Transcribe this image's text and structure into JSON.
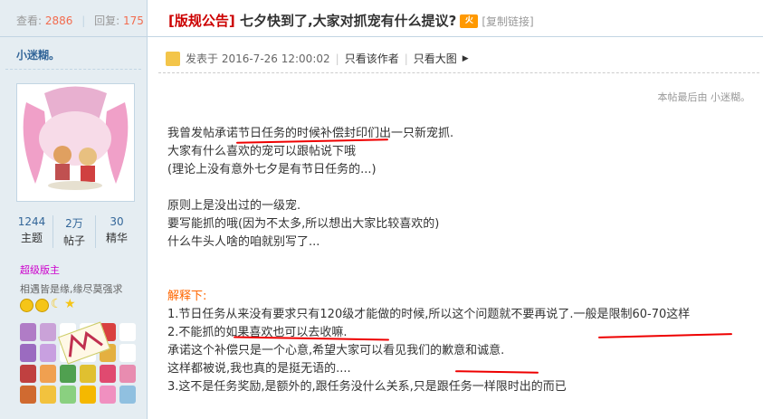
{
  "sidebar": {
    "views_label": "查看:",
    "views": "2886",
    "replies_label": "回复:",
    "replies": "175",
    "username": "小迷糊。",
    "counts": [
      {
        "value": "1244",
        "label": "主题"
      },
      {
        "value": "2万",
        "label": "帖子"
      },
      {
        "value": "30",
        "label": "精华"
      }
    ],
    "role": "超级版主",
    "motto": "相遇皆是缘,缘尽莫强求"
  },
  "post": {
    "tag": "[版规公告]",
    "title": " 七夕快到了,大家对抓宠有什么提议?",
    "copy_link": "[复制链接]",
    "posted_at": "发表于 2016-7-26 12:00:02",
    "only_author": "只看该作者",
    "view_large": "只看大图",
    "last_edit": "本帖最后由 小迷糊。",
    "lines": [
      "我曾发帖承诺节日任务的时候补偿封印们出一只新宠抓.",
      "大家有什么喜欢的宠可以跟帖说下哦",
      "(理论上没有意外七夕是有节日任务的...)",
      "",
      "原则上是没出过的一级宠.",
      "要写能抓的哦(因为不太多,所以想出大家比较喜欢的)",
      "什么牛头人啥的咱就别写了...",
      "",
      "",
      "解释下:",
      "1.节日任务从来没有要求只有120级才能做的时候,所以这个问题就不要再说了.一般是限制60-70这样",
      "2.不能抓的如果喜欢也可以去收嘛.",
      "承诺这个补偿只是一个心意,希望大家可以看见我们的歉意和诚意.",
      "这样都被说,我也真的是挺无语的....",
      "3.这不是任务奖励,是额外的,跟任务没什么关系,只是跟任务一样限时出的而已"
    ]
  },
  "colors": {
    "accent": "#369",
    "tag_red": "#c00",
    "scribble": "#e00",
    "sidebar_bg": "#e5edf2"
  }
}
